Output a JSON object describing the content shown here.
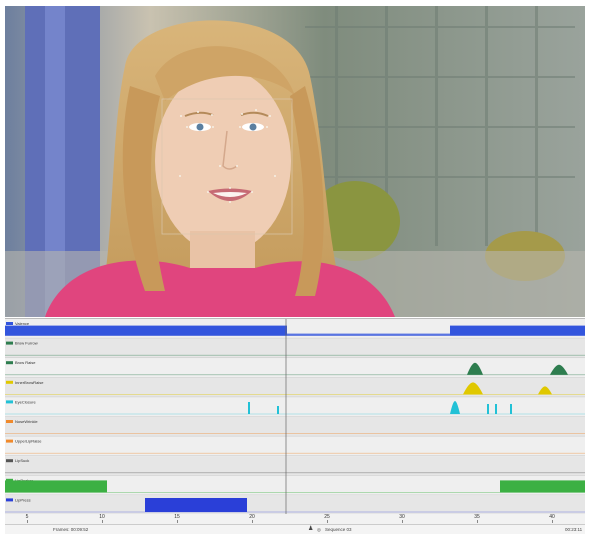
{
  "video": {
    "tracking_points": 14
  },
  "tracks": [
    {
      "label": "Valence",
      "color": "#3355dd"
    },
    {
      "label": "Brow Furrow",
      "color": "#2e7d4f"
    },
    {
      "label": "Brow Raise",
      "color": "#2e7d4f"
    },
    {
      "label": "InnerBrowRaise",
      "color": "#e0c800"
    },
    {
      "label": "EyeClosure",
      "color": "#22c1d6"
    },
    {
      "label": "NoseWrinkle",
      "color": "#f08a2c"
    },
    {
      "label": "UpperLipRaise",
      "color": "#f08a2c"
    },
    {
      "label": "LipSuck",
      "color": "#555555"
    },
    {
      "label": "LipPucker",
      "color": "#3cb043"
    },
    {
      "label": "LipPress",
      "color": "#2a3fd8"
    }
  ],
  "axis": {
    "ticks": [
      "5",
      "10",
      "15",
      "20",
      "25",
      "30",
      "35",
      "40"
    ]
  },
  "status": {
    "left_text": "Frames: 00:09:52",
    "center_text": "Sequence 03",
    "right_text": "00:23:11"
  },
  "colors": {
    "valence_fill": "#3355dd",
    "playhead": "#666666"
  }
}
